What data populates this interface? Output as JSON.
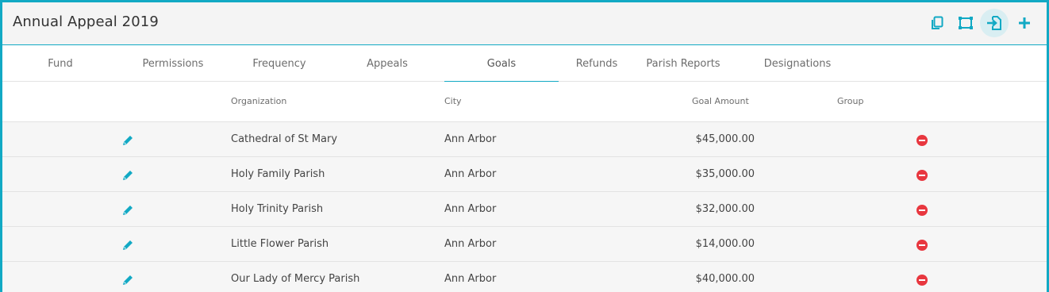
{
  "header": {
    "title": "Annual Appeal 2019",
    "actions": [
      "copy-icon",
      "fit-screen-icon",
      "import-icon",
      "plus-icon"
    ],
    "accent_color": "#12a9c4"
  },
  "tabs": [
    {
      "label": "Fund"
    },
    {
      "label": "Permissions"
    },
    {
      "label": "Frequency"
    },
    {
      "label": "Appeals"
    },
    {
      "label": "Goals",
      "active": true
    },
    {
      "label": "Refunds"
    },
    {
      "label": "Parish Reports"
    },
    {
      "label": "Designations"
    }
  ],
  "table": {
    "columns": {
      "organization": "Organization",
      "city": "City",
      "goal_amount": "Goal Amount",
      "group": "Group"
    },
    "rows": [
      {
        "organization": "Cathedral of St Mary",
        "city": "Ann Arbor",
        "goal_amount": "$45,000.00",
        "group": ""
      },
      {
        "organization": "Holy Family Parish",
        "city": "Ann Arbor",
        "goal_amount": "$35,000.00",
        "group": ""
      },
      {
        "organization": "Holy Trinity Parish",
        "city": "Ann Arbor",
        "goal_amount": "$32,000.00",
        "group": ""
      },
      {
        "organization": "Little Flower Parish",
        "city": "Ann Arbor",
        "goal_amount": "$14,000.00",
        "group": ""
      },
      {
        "organization": "Our Lady of Mercy Parish",
        "city": "Ann Arbor",
        "goal_amount": "$40,000.00",
        "group": ""
      }
    ],
    "remove_color": "#e8373f"
  }
}
